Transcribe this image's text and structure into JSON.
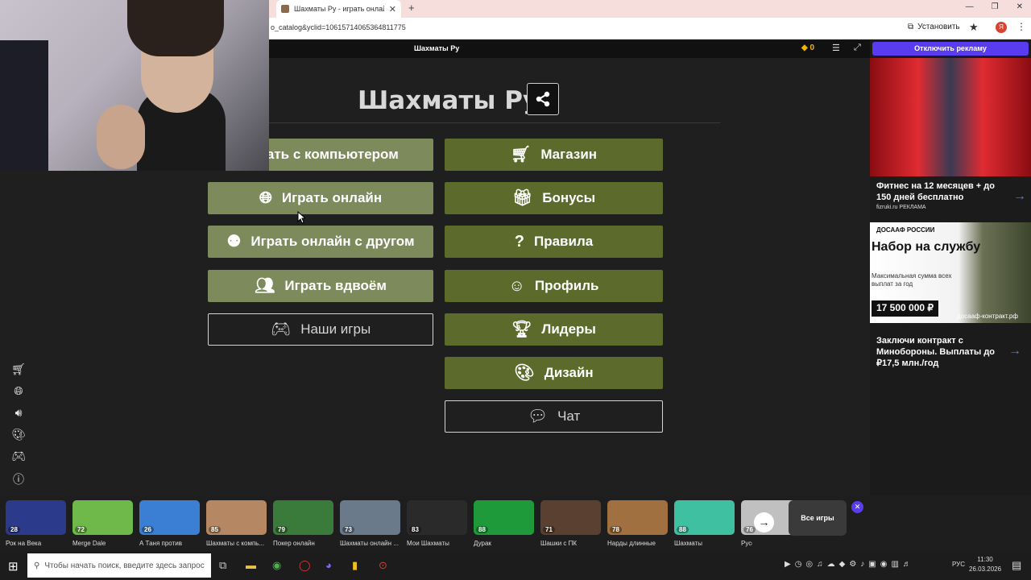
{
  "browser": {
    "tab_title": "Шахматы Ру - играть онлайн б",
    "url": "o_catalog&yclid=10615714065364811775",
    "install_label": "Установить",
    "profile_letter": "Я"
  },
  "game_bar": {
    "title": "Шахматы Ру",
    "coins": "0",
    "disable_ads_label": "Отключить рекламу"
  },
  "main": {
    "title": "Шахматы Ру",
    "left_buttons": [
      {
        "label": "Играть с компьютером",
        "icon": "computer-icon"
      },
      {
        "label": "Играть онлайн",
        "icon": "globe-icon"
      },
      {
        "label": "Играть онлайн с другом",
        "icon": "friend-online-icon"
      },
      {
        "label": "Играть вдвоём",
        "icon": "two-players-icon"
      },
      {
        "label": "Наши игры",
        "icon": "gamepad-icon"
      }
    ],
    "right_buttons": [
      {
        "label": "Магазин",
        "icon": "cart-icon"
      },
      {
        "label": "Бонусы",
        "icon": "gift-icon"
      },
      {
        "label": "Правила",
        "icon": "question-icon"
      },
      {
        "label": "Профиль",
        "icon": "user-icon"
      },
      {
        "label": "Лидеры",
        "icon": "trophy-icon"
      },
      {
        "label": "Дизайн",
        "icon": "palette-icon"
      },
      {
        "label": "Чат",
        "icon": "chat-icon"
      }
    ]
  },
  "ads": {
    "ad1_text": "Фитнес на 12 месяцев + до 150 дней бесплатно",
    "ad1_source": "fizruki.ru",
    "ad1_tag": "РЕКЛАМА",
    "ad2_logo": "ДОСААФ РОССИИ",
    "ad2_headline": "Набор на службу",
    "ad2_sub": "Максимальная сумма всех выплат за год",
    "ad2_sum": "17 500 000 ₽",
    "ad2_url": "досааф-контракт.рф",
    "ad2_text": "Заключи контракт с Минобороны. Выплаты до ₽17,5 млн./год"
  },
  "catalog": {
    "items": [
      {
        "name": "Рок на Века",
        "rating": "28",
        "color": "#2b3a8a"
      },
      {
        "name": "Merge Dale",
        "rating": "72",
        "color": "#6fb84a"
      },
      {
        "name": "А Таня против",
        "rating": "26",
        "color": "#3b7fd4"
      },
      {
        "name": "Шахматы с компь...",
        "rating": "85",
        "color": "#b58863"
      },
      {
        "name": "Покер онлайн",
        "rating": "79",
        "color": "#3a7a3a"
      },
      {
        "name": "Шахматы онлайн ...",
        "rating": "73",
        "color": "#6a7a8a"
      },
      {
        "name": "Мои Шахматы",
        "rating": "83",
        "color": "#2a2a2a"
      },
      {
        "name": "Дурак",
        "rating": "88",
        "color": "#1e9a3a"
      },
      {
        "name": "Шашки с ПК",
        "rating": "71",
        "color": "#5a4030"
      },
      {
        "name": "Нарды длинные",
        "rating": "78",
        "color": "#a07040"
      },
      {
        "name": "Шахматы",
        "rating": "88",
        "color": "#3fc0a0"
      },
      {
        "name": "Русские",
        "rating": "76",
        "color": "#c0c0c0"
      }
    ],
    "all_games_label": "Все игры"
  },
  "taskbar": {
    "search_placeholder": "Чтобы начать поиск, введите здесь запрос",
    "lang": "РУС",
    "time": "11:30",
    "date": "26.03.2026"
  }
}
